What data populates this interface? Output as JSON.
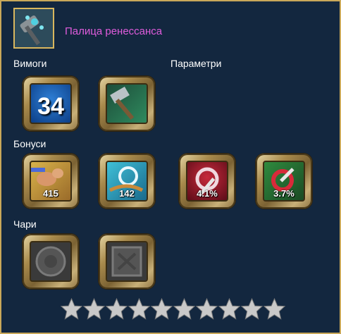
{
  "item": {
    "name": "Палица ренессанса",
    "icon": "hammer-icon"
  },
  "sections": {
    "requirements_label": "Вимоги",
    "parameters_label": "Параметри",
    "bonuses_label": "Бонуси",
    "charms_label": "Чари"
  },
  "requirements": {
    "level": "34",
    "weapon_type_icon": "hammer-weapon-icon"
  },
  "bonuses": [
    {
      "icon": "strength-arm-icon",
      "value": "415"
    },
    {
      "icon": "wind-swirl-icon",
      "value": "142"
    },
    {
      "icon": "critical-sword-icon",
      "value": "4.1%"
    },
    {
      "icon": "critical-damage-icon",
      "value": "3.7%"
    }
  ],
  "charms": [
    {
      "icon": "empty-charm-socket-round-icon"
    },
    {
      "icon": "empty-charm-socket-square-icon"
    }
  ],
  "rating": {
    "filled": 0,
    "total": 10,
    "icon": "star-icon"
  },
  "colors": {
    "background": "#13273f",
    "border": "#c9a85a",
    "item_name": "#e05cdc",
    "text": "#ffffff"
  }
}
